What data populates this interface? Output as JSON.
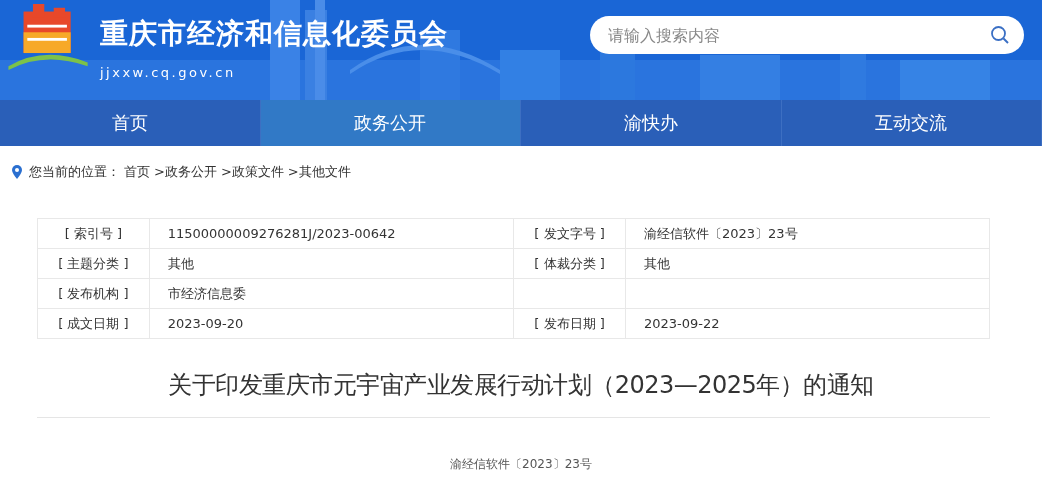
{
  "header": {
    "title": "重庆市经济和信息化委员会",
    "url": "jjxxw.cq.gov.cn",
    "search": {
      "placeholder": "请输入搜索内容"
    }
  },
  "nav": [
    {
      "label": "首页",
      "selected": false
    },
    {
      "label": "政务公开",
      "selected": true
    },
    {
      "label": "渝快办",
      "selected": false
    },
    {
      "label": "互动交流",
      "selected": false
    }
  ],
  "breadcrumb": {
    "label": "您当前的位置：",
    "items": [
      "首页",
      ">政务公开",
      ">政策文件",
      ">其他文件"
    ]
  },
  "info_table": [
    {
      "cells": [
        "[ 索引号 ]",
        "11500000009276281J/2023-00642",
        "[ 发文字号 ]",
        "渝经信软件〔2023〕23号"
      ]
    },
    {
      "cells": [
        "[ 主题分类 ]",
        "其他",
        "[ 体裁分类 ]",
        "其他"
      ]
    },
    {
      "cells": [
        "[ 发布机构 ]",
        "市经济信息委"
      ]
    },
    {
      "cells": [
        "[ 成文日期 ]",
        "2023-09-20",
        "[ 发布日期 ]",
        "2023-09-22"
      ]
    }
  ],
  "article": {
    "title": "关于印发重庆市元宇宙产业发展行动计划（2023—2025年）的通知",
    "doc_number": "渝经信软件〔2023〕23号"
  }
}
